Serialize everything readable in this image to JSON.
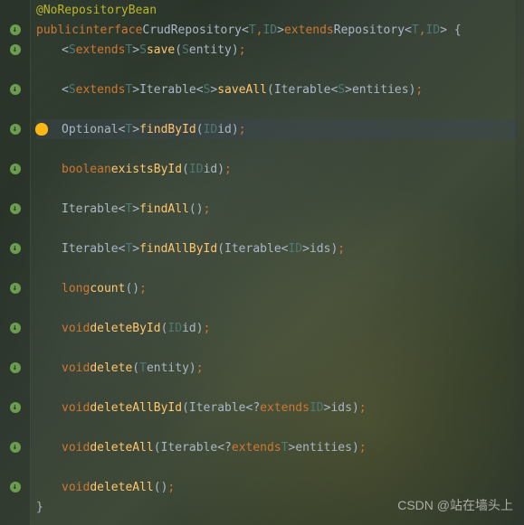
{
  "annotation": "@NoRepositoryBean",
  "decl": {
    "public": "public",
    "interface": "interface",
    "name": "CrudRepository",
    "t": "T",
    "id": "ID",
    "extends": "extends",
    "parent": "Repository"
  },
  "lines": {
    "save": {
      "s": "S",
      "ext": "extends",
      "t": "T",
      "ret": "S",
      "name": "save",
      "p1": "S",
      "p1n": "entity"
    },
    "saveAll": {
      "s": "S",
      "ext": "extends",
      "t": "T",
      "ret": "Iterable",
      "retg": "S",
      "name": "saveAll",
      "p1": "Iterable",
      "p1g": "S",
      "p1n": "entities"
    },
    "findById": {
      "ret": "Optional",
      "retg": "T",
      "name": "findById",
      "p1": "ID",
      "p1n": "id"
    },
    "existsById": {
      "ret": "boolean",
      "name": "existsById",
      "p1": "ID",
      "p1n": "id"
    },
    "findAll": {
      "ret": "Iterable",
      "retg": "T",
      "name": "findAll"
    },
    "findAllById": {
      "ret": "Iterable",
      "retg": "T",
      "name": "findAllById",
      "p1": "Iterable",
      "p1g": "ID",
      "p1n": "ids"
    },
    "count": {
      "ret": "long",
      "name": "count"
    },
    "deleteById": {
      "ret": "void",
      "name": "deleteById",
      "p1": "ID",
      "p1n": "id"
    },
    "delete": {
      "ret": "void",
      "name": "delete",
      "p1": "T",
      "p1n": "entity"
    },
    "deleteAllById": {
      "ret": "void",
      "name": "deleteAllById",
      "p1": "Iterable",
      "wild": "?",
      "ext": "extends",
      "p1g": "ID",
      "p1n": "ids"
    },
    "deleteAll1": {
      "ret": "void",
      "name": "deleteAll",
      "p1": "Iterable",
      "wild": "?",
      "ext": "extends",
      "p1g": "T",
      "p1n": "entities"
    },
    "deleteAll2": {
      "ret": "void",
      "name": "deleteAll"
    }
  },
  "brace_close": "}",
  "watermark": "CSDN @站在墙头上"
}
